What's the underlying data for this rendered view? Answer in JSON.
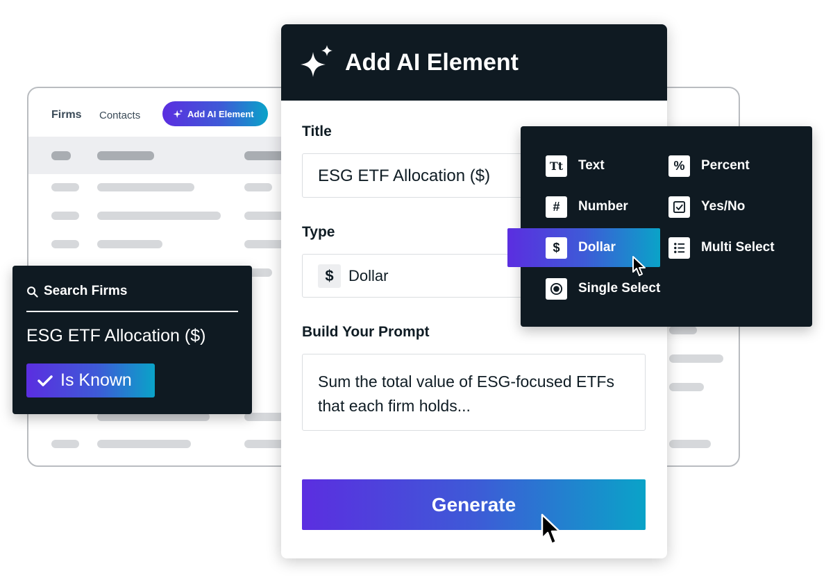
{
  "background_table": {
    "tabs": [
      "Firms",
      "Contacts"
    ],
    "add_button_label": "Add AI Element"
  },
  "search_panel": {
    "heading": "Search Firms",
    "value": "ESG ETF Allocation ($)",
    "filter_badge": "Is Known"
  },
  "modal": {
    "title": "Add AI Element",
    "title_label": "Title",
    "title_value": "ESG ETF Allocation ($)",
    "type_label": "Type",
    "type_symbol": "$",
    "type_value": "Dollar",
    "prompt_label": "Build Your Prompt",
    "prompt_value": "Sum the total value of ESG-focused ETFs that each firm holds...",
    "generate_label": "Generate"
  },
  "type_menu": {
    "selected": "Dollar",
    "items": [
      {
        "label": "Text",
        "icon": "text-icon",
        "glyph": "Tt"
      },
      {
        "label": "Percent",
        "icon": "percent-icon",
        "glyph": "%"
      },
      {
        "label": "Number",
        "icon": "hash-icon",
        "glyph": "#"
      },
      {
        "label": "Yes/No",
        "icon": "checkbox-icon",
        "glyph": ""
      },
      {
        "label": "Dollar",
        "icon": "dollar-icon",
        "glyph": "$"
      },
      {
        "label": "Multi Select",
        "icon": "list-icon",
        "glyph": ""
      },
      {
        "label": "Single Select",
        "icon": "radio-icon",
        "glyph": ""
      }
    ]
  },
  "colors": {
    "dark_panel": "#0f1a22",
    "gradient_start": "#5b2ee0",
    "gradient_end": "#0aa3c8"
  }
}
